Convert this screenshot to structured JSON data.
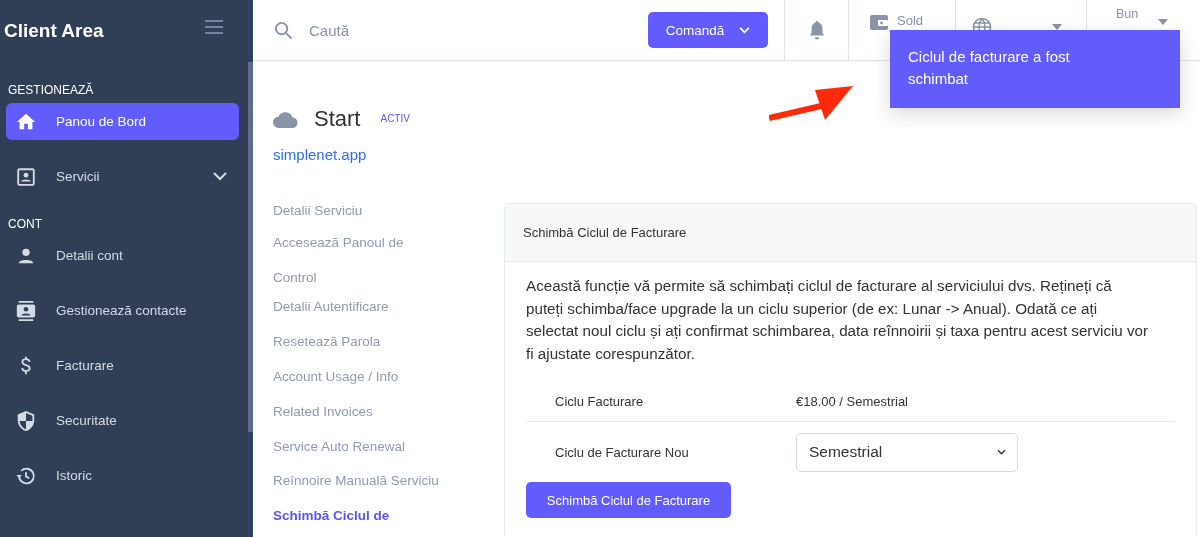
{
  "sidebar": {
    "title": "Client Area",
    "sections": [
      {
        "heading": "GESTIONEAZĂ",
        "items": [
          {
            "label": "Panou de Bord",
            "selected": true
          },
          {
            "label": "Servicii",
            "selected": false,
            "expanded": false
          }
        ]
      },
      {
        "heading": "CONT",
        "items": [
          {
            "label": "Detalii cont",
            "selected": false
          },
          {
            "label": "Gestionează contacte",
            "selected": false
          },
          {
            "label": "Facturare",
            "selected": false
          },
          {
            "label": "Securitate",
            "selected": false
          },
          {
            "label": "Istoric",
            "selected": false
          }
        ]
      }
    ]
  },
  "topbar": {
    "search": {
      "placeholder": "Caută"
    },
    "order_button": "Comandă",
    "balance_label": "Sold",
    "greeting": "Bun"
  },
  "toast": {
    "message": "Ciclul de facturare a fost schimbat"
  },
  "service": {
    "title": "Start",
    "status": "ACTIV",
    "domain": "simplenet.app"
  },
  "service_nav": [
    {
      "label": "Detalii Serviciu",
      "selected": false
    },
    {
      "label": "Accesează Panoul de Control",
      "selected": false
    },
    {
      "label": "Detalii Autentificare",
      "selected": false
    },
    {
      "label": "Resetează Parola",
      "selected": false
    },
    {
      "label": "Account Usage / Info",
      "selected": false
    },
    {
      "label": "Related Invoices",
      "selected": false
    },
    {
      "label": "Service Auto Renewal",
      "selected": false
    },
    {
      "label": "Reînnoire Manuală Serviciu",
      "selected": false
    },
    {
      "label": "Schimbă Ciclul de",
      "selected": true
    }
  ],
  "card": {
    "title": "Schimbă Ciclul de Facturare",
    "description": "Această funcție vă permite să schimbați ciclul de facturare al serviciului dvs. Rețineți că puteți schimba/face upgrade la un ciclu superior (de ex: Lunar -> Anual). Odată ce ați selectat noul ciclu și ați confirmat schimbarea, data reînnoirii și taxa pentru acest serviciu vor fi ajustate corespunzător.",
    "current": {
      "label": "Ciclu Facturare",
      "value": "€18.00 / Semestrial"
    },
    "new_cycle": {
      "label": "Ciclu de Facturare Nou",
      "value": "Semestrial"
    },
    "submit": "Schimbă Ciclul de Facturare"
  }
}
